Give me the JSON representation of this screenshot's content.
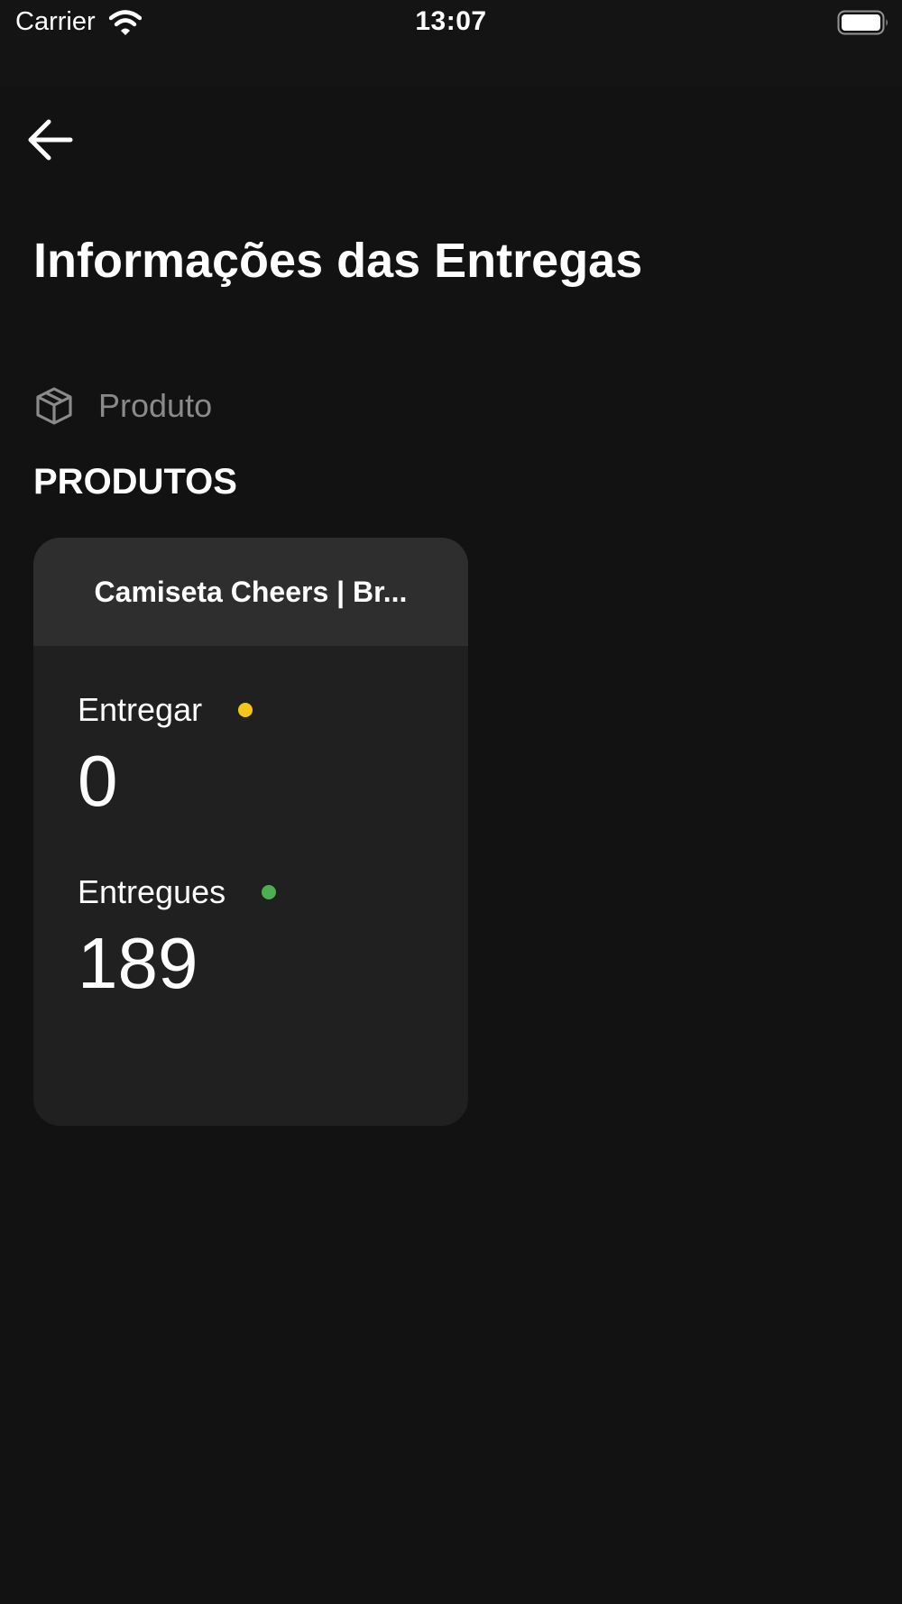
{
  "status_bar": {
    "carrier": "Carrier",
    "time": "13:07",
    "icons": [
      "wifi-icon",
      "battery-icon"
    ]
  },
  "nav": {
    "back_icon": "arrow-left-icon"
  },
  "page": {
    "title": "Informações das Entregas",
    "filter_label": "Produto",
    "filter_icon": "cube-icon",
    "section_heading": "PRODUTOS"
  },
  "products": [
    {
      "name": "Camiseta Cheers | Br...",
      "pending_label": "Entregar",
      "pending_value": "0",
      "delivered_label": "Entregues",
      "delivered_value": "189"
    }
  ],
  "colors": {
    "background": "#121212",
    "card": "#202020",
    "card_header": "#2e2e2e",
    "pending_dot": "#f5c518",
    "delivered_dot": "#4caf50",
    "muted_text": "#8a8a8a"
  }
}
